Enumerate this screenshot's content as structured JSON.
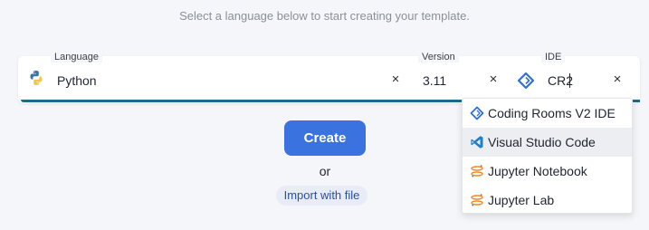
{
  "header": {
    "subtitle": "Select a language below to start creating your template."
  },
  "form": {
    "language": {
      "label": "Language",
      "value": "Python",
      "icon": "python-icon",
      "clear_glyph": "×"
    },
    "version": {
      "label": "Version",
      "value": "3.11",
      "clear_glyph": "×"
    },
    "ide": {
      "label": "IDE",
      "value": "CR2",
      "icon": "coding-rooms-icon",
      "clear_glyph": "×"
    }
  },
  "dropdown": {
    "options": [
      {
        "label": "Coding Rooms V2 IDE",
        "icon": "coding-rooms-icon"
      },
      {
        "label": "Visual Studio Code",
        "icon": "vscode-icon",
        "highlighted": true
      },
      {
        "label": "Jupyter Notebook",
        "icon": "jupyter-icon"
      },
      {
        "label": "Jupyter Lab",
        "icon": "jupyter-icon"
      }
    ]
  },
  "actions": {
    "create_label": "Create",
    "or_label": "or",
    "import_label": "Import with file"
  },
  "colors": {
    "primary": "#3a73e0",
    "accent_bar": "#1a6b8c",
    "link": "#2a4f9e",
    "link_bg": "#e8ecf6"
  }
}
